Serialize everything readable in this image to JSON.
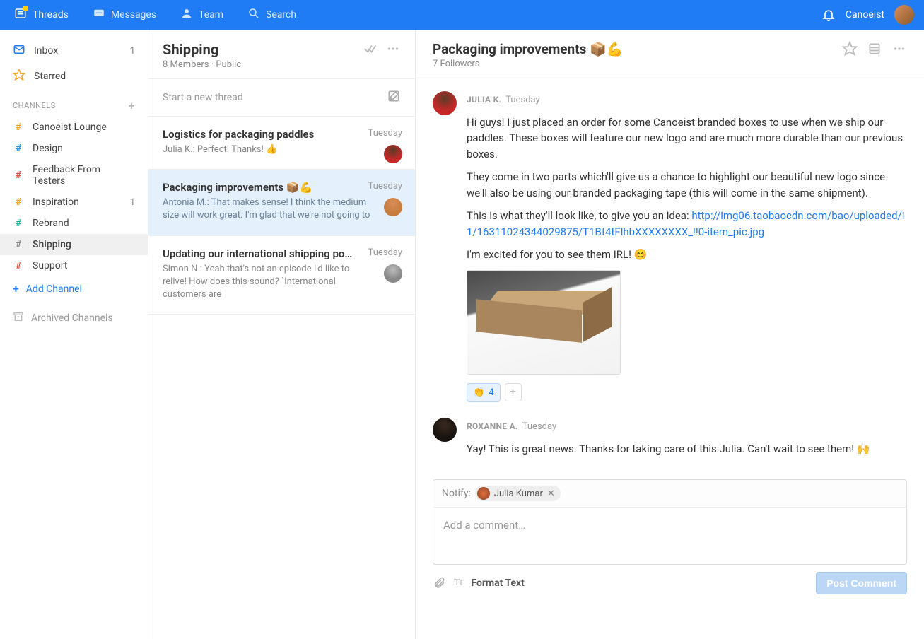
{
  "topbar": {
    "threads": "Threads",
    "messages": "Messages",
    "team": "Team",
    "search": "Search",
    "username": "Canoeist"
  },
  "sidebar": {
    "inbox": "Inbox",
    "inbox_count": "1",
    "starred": "Starred",
    "channels_label": "CHANNELS",
    "channels": [
      {
        "name": "Canoeist Lounge",
        "hash_color": "orange",
        "count": ""
      },
      {
        "name": "Design",
        "hash_color": "blue",
        "count": ""
      },
      {
        "name": "Feedback From Testers",
        "hash_color": "red",
        "count": ""
      },
      {
        "name": "Inspiration",
        "hash_color": "orange",
        "count": "1"
      },
      {
        "name": "Rebrand",
        "hash_color": "teal",
        "count": ""
      },
      {
        "name": "Shipping",
        "hash_color": "gray",
        "count": ""
      },
      {
        "name": "Support",
        "hash_color": "red",
        "count": ""
      }
    ],
    "add_channel": "Add Channel",
    "archived": "Archived Channels"
  },
  "channel_header": {
    "title": "Shipping",
    "subtitle": "8 Members  ·  Public",
    "compose_placeholder": "Start a new thread"
  },
  "threads": [
    {
      "title": "Logistics for packaging paddles",
      "snippet": "Julia K.: Perfect! Thanks! 👍",
      "time": "Tuesday",
      "avatar_class": "avatar-red",
      "selected": false
    },
    {
      "title": "Packaging improvements 📦💪",
      "snippet": "Antonia M.: That makes sense! I think the medium size will work great. I'm glad that we're not going to",
      "time": "Tuesday",
      "avatar_class": "avatar-orange",
      "selected": true
    },
    {
      "title": "Updating our international shipping po…",
      "snippet": "Simon N.: Yeah that's not an episode I'd like to relive! How does this sound?  `International customers are",
      "time": "Tuesday",
      "avatar_class": "avatar-gray",
      "selected": false
    }
  ],
  "detail": {
    "title": "Packaging improvements 📦💪",
    "subtitle": "7 Followers",
    "messages": [
      {
        "author": "JULIA K.",
        "time": "Tuesday",
        "avatar_class": "avatar-red",
        "p1": "Hi guys! I just placed an order for some Canoeist branded boxes to use when we ship our paddles. These boxes will feature our new logo and are much more durable than our previous boxes.",
        "p2": "They come in two parts which'll give us a chance to highlight our beautiful new logo since we'll also be using our branded packaging tape (this will come in the same shipment).",
        "p3_pre": "This is what they'll look like, to give you an idea:",
        "link": "http://img06.taobaocdn.com/bao/uploaded/i1/16311024344029875/T1Bf4tFlhbXXXXXXXX_!!0-item_pic.jpg",
        "p4": "I'm excited for you to see them IRL! 😊",
        "reaction_emoji": "👏",
        "reaction_count": "4"
      },
      {
        "author": "ROXANNE A.",
        "time": "Tuesday",
        "avatar_class": "avatar-dark",
        "p1": "Yay! This is great news. Thanks for taking care of this Julia. Can't wait to see them! 🙌"
      }
    ],
    "notify_label": "Notify:",
    "notify_chip": "Julia Kumar",
    "comment_placeholder": "Add a comment…",
    "format_text": "Format Text",
    "post_button": "Post Comment"
  }
}
